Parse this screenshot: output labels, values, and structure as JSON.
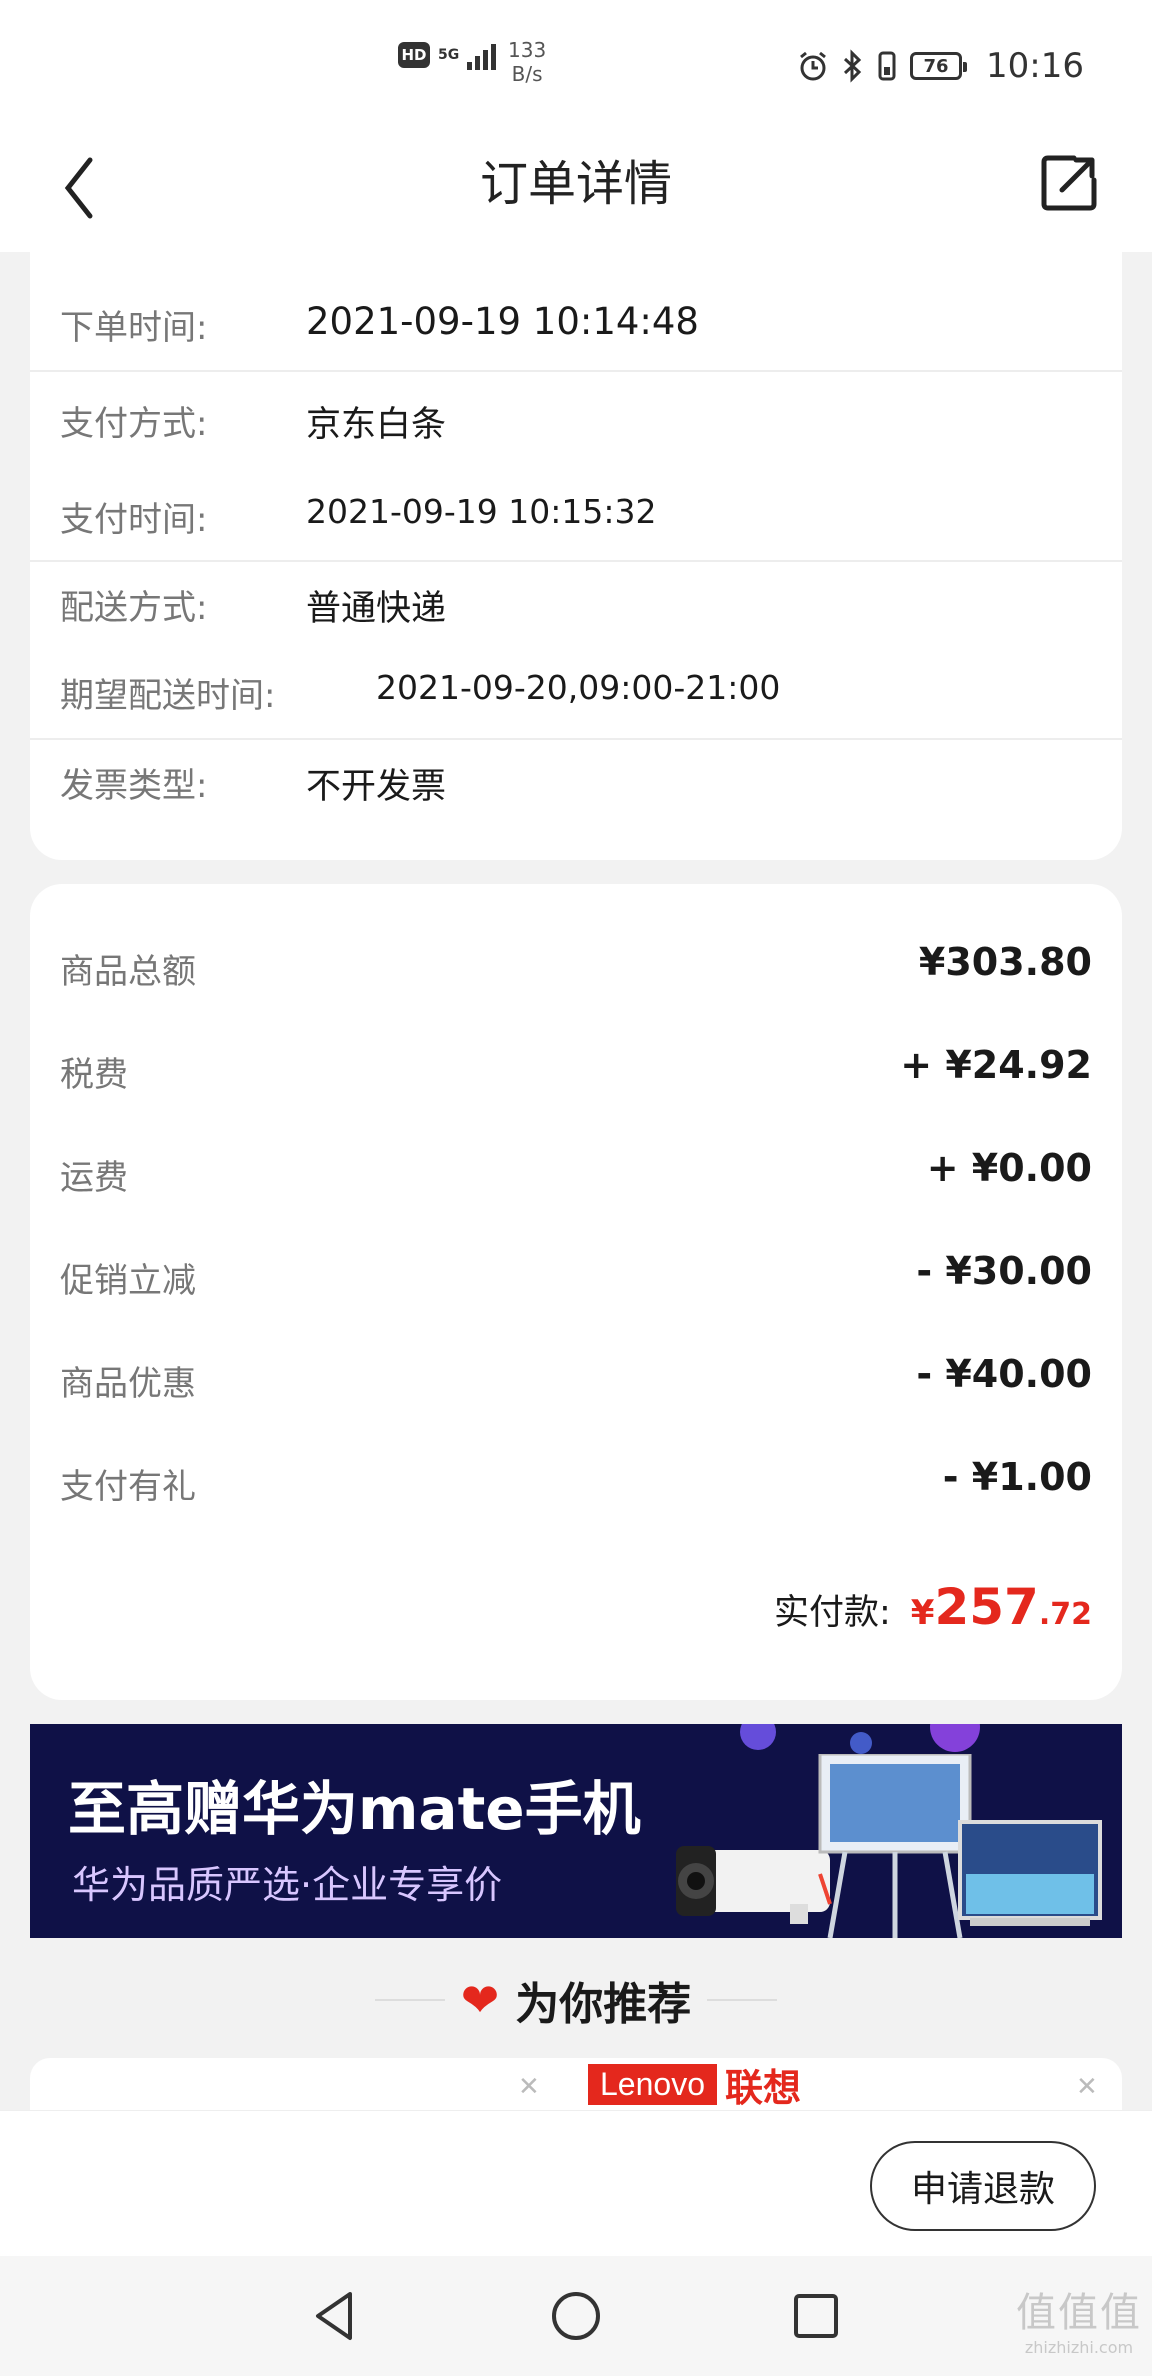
{
  "status_bar": {
    "hd": "HD",
    "network": "5G",
    "speed_value": "133",
    "speed_unit": "B/s",
    "battery": "76",
    "time": "10:16"
  },
  "header": {
    "title": "订单详情",
    "back_icon": "chevron-left-icon",
    "share_icon": "share-icon"
  },
  "order_info": [
    {
      "label": "下单时间:",
      "value": "2021-09-19 10:14:48"
    },
    {
      "label": "支付方式:",
      "value": "京东白条"
    },
    {
      "label": "支付时间:",
      "value": "2021-09-19 10:15:32"
    },
    {
      "label": "配送方式:",
      "value": "普通快递"
    },
    {
      "label": "期望配送时间:",
      "value": "2021-09-20,09:00-21:00"
    },
    {
      "label": "发票类型:",
      "value": "不开发票"
    }
  ],
  "price_detail": [
    {
      "label": "商品总额",
      "value": "¥303.80"
    },
    {
      "label": "税费",
      "value": "+ ¥24.92"
    },
    {
      "label": "运费",
      "value": "+ ¥0.00"
    },
    {
      "label": "促销立减",
      "value": "- ¥30.00"
    },
    {
      "label": "商品优惠",
      "value": "- ¥40.00"
    },
    {
      "label": "支付有礼",
      "value": "- ¥1.00"
    }
  ],
  "paid": {
    "label": "实付款:",
    "currency": "¥",
    "integer": "257",
    "decimal": ".72"
  },
  "banner": {
    "title": "至高赠华为mate手机",
    "subtitle": "华为品质严选·企业专享价"
  },
  "recommend": {
    "title": "为你推荐",
    "brand_en": "Lenovo",
    "brand_cn": "联想"
  },
  "actions": {
    "refund_label": "申请退款"
  },
  "watermark": {
    "big": "值值值",
    "small": "zhizhizhi.com"
  },
  "colors": {
    "accent_red": "#e4281d",
    "banner_bg": "#0f1147"
  }
}
